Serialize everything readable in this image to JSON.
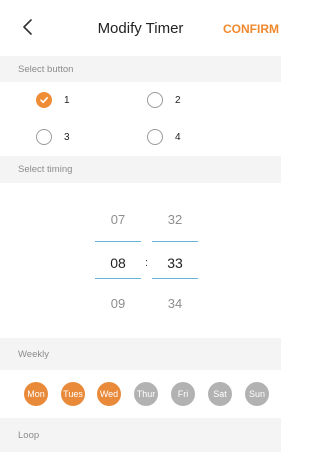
{
  "header": {
    "title": "Modify Timer",
    "confirm_label": "CONFIRM"
  },
  "colors": {
    "accent": "#f0892e",
    "day_selected": "#e98a3a",
    "day_unselected": "#b2b2b2",
    "picker_line": "#69b4d9",
    "section_bg": "#f4f4f4"
  },
  "select_button": {
    "label": "Select button",
    "options": [
      {
        "label": "1",
        "checked": true
      },
      {
        "label": "2",
        "checked": false
      },
      {
        "label": "3",
        "checked": false
      },
      {
        "label": "4",
        "checked": false
      }
    ]
  },
  "select_timing": {
    "label": "Select timing",
    "hours": {
      "prev": "07",
      "selected": "08",
      "next": "09"
    },
    "minutes": {
      "prev": "32",
      "selected": "33",
      "next": "34"
    },
    "separator": ":"
  },
  "weekly": {
    "label": "Weekly",
    "days": [
      {
        "label": "Mon",
        "selected": true
      },
      {
        "label": "Tues",
        "selected": true
      },
      {
        "label": "Wed",
        "selected": true
      },
      {
        "label": "Thur",
        "selected": false
      },
      {
        "label": "Fri",
        "selected": false
      },
      {
        "label": "Sat",
        "selected": false
      },
      {
        "label": "Sun",
        "selected": false
      }
    ]
  },
  "loop": {
    "label": "Loop"
  }
}
